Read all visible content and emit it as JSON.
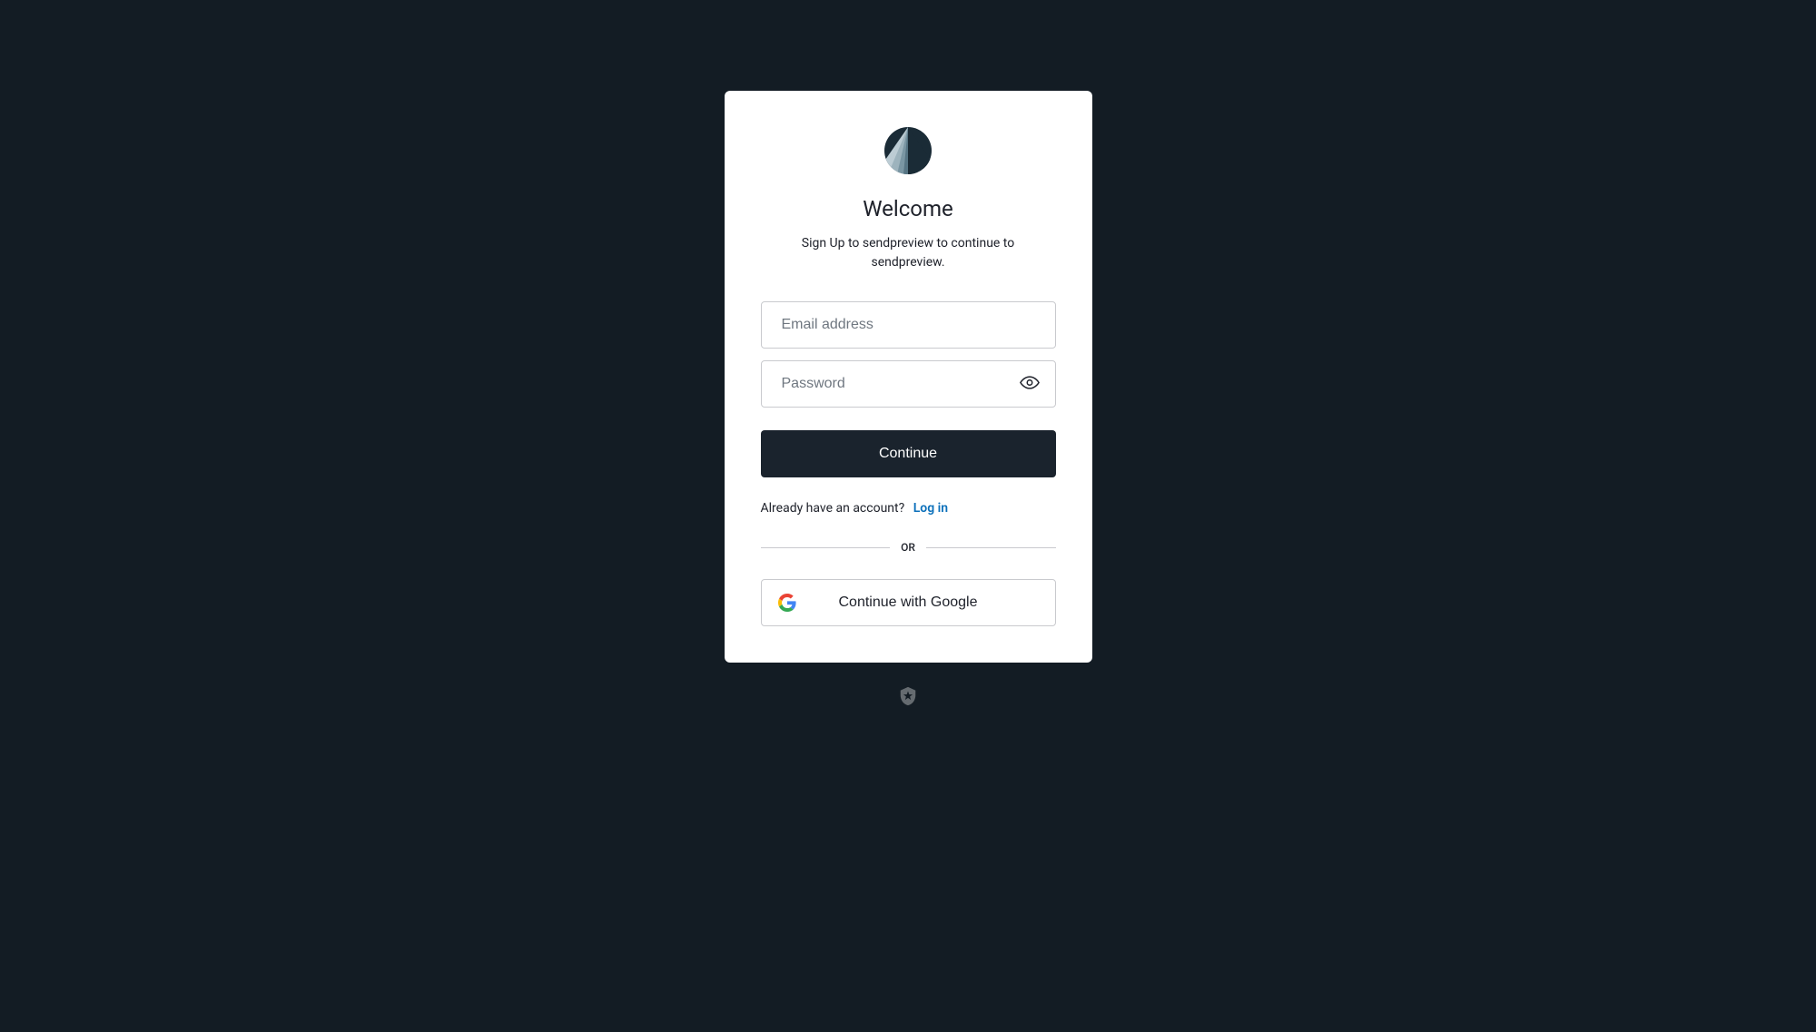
{
  "header": {
    "title": "Welcome",
    "subtitle": "Sign Up to sendpreview to continue to sendpreview."
  },
  "form": {
    "email_placeholder": "Email address",
    "password_placeholder": "Password",
    "continue_label": "Continue"
  },
  "login": {
    "prompt": "Already have an account?",
    "link_label": "Log in"
  },
  "divider": {
    "label": "OR"
  },
  "social": {
    "google_label": "Continue with Google"
  }
}
